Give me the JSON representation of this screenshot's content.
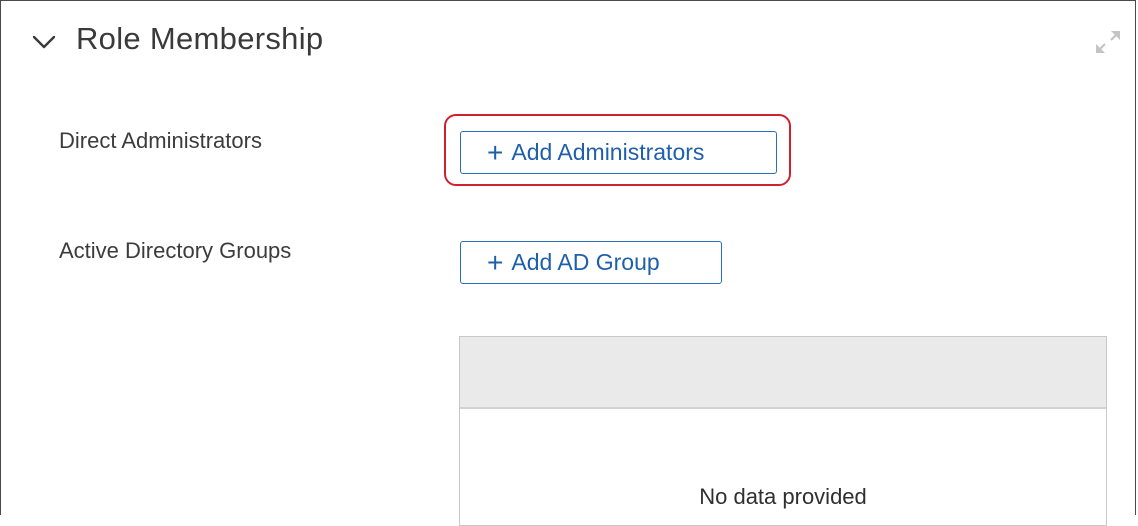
{
  "section": {
    "title": "Role Membership",
    "collapse_icon": "chevron-down-icon",
    "expand_icon": "expand-arrows-icon"
  },
  "rows": {
    "direct_admins": {
      "label": "Direct Administrators",
      "button_plus": "+",
      "button_label": "Add Administrators"
    },
    "ad_groups": {
      "label": "Active Directory Groups",
      "button_plus": "+",
      "button_label": "Add AD Group"
    }
  },
  "table": {
    "empty_message": "No data provided"
  },
  "colors": {
    "accent": "#1f5fab",
    "highlight": "#d0202f",
    "table_header_bg": "#eaeaea"
  }
}
